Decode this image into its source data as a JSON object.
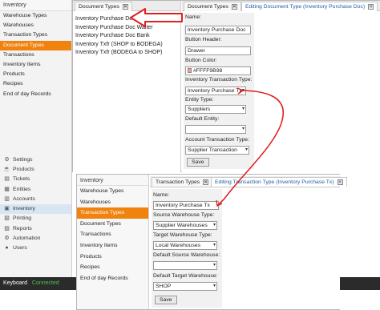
{
  "sidebar": {
    "header": "Inventory",
    "items": [
      {
        "label": "Warehouse Types",
        "active": false
      },
      {
        "label": "Warehouses",
        "active": false
      },
      {
        "label": "Transaction Types",
        "active": false
      },
      {
        "label": "Document Types",
        "active": true
      },
      {
        "label": "Transactions",
        "active": false
      },
      {
        "label": "Inventory Items",
        "active": false
      },
      {
        "label": "Products",
        "active": false
      },
      {
        "label": "Recipes",
        "active": false
      },
      {
        "label": "End of day Records",
        "active": false
      }
    ],
    "nav": [
      {
        "label": "Settings",
        "icon": "gear-icon",
        "glyph": "⚙",
        "active": false
      },
      {
        "label": "Products",
        "icon": "products-icon",
        "glyph": "☕",
        "active": false
      },
      {
        "label": "Tickets",
        "icon": "tickets-icon",
        "glyph": "▤",
        "active": false
      },
      {
        "label": "Entities",
        "icon": "entities-icon",
        "glyph": "▦",
        "active": false
      },
      {
        "label": "Accounts",
        "icon": "accounts-icon",
        "glyph": "▥",
        "active": false
      },
      {
        "label": "Inventory",
        "icon": "inventory-icon",
        "glyph": "▣",
        "active": true
      },
      {
        "label": "Printing",
        "icon": "printing-icon",
        "glyph": "▧",
        "active": false
      },
      {
        "label": "Reports",
        "icon": "reports-icon",
        "glyph": "▨",
        "active": false
      },
      {
        "label": "Automation",
        "icon": "automation-icon",
        "glyph": "⚙",
        "active": false
      },
      {
        "label": "Users",
        "icon": "users-icon",
        "glyph": "●",
        "active": false
      }
    ]
  },
  "bottombar": {
    "keyboard": "Keyboard",
    "status": "Connected"
  },
  "top": {
    "tabs": {
      "list": "Document Types",
      "list_small": "Document Types",
      "editing": "Editing Document Type (Inventory Purchase Doc)"
    },
    "documents": [
      "Inventory Purchase Doc",
      "Inventory Purchase Doc Waiter",
      "Inventory Purchase Doc Bank",
      "Inventory Txfr (SHOP to BODEGA)",
      "Inventory Txfr (BODEGA to SHOP)"
    ],
    "form": {
      "name_label": "Name:",
      "name_value": "Inventory Purchase Doc",
      "button_header_label": "Button Header:",
      "button_header_value": "Drawer",
      "button_color_label": "Button Color:",
      "button_color_value": "#FFFF9B98",
      "button_color_swatch": "#ff9b98",
      "inv_tx_type_label": "Inventory Transaction Type:",
      "inv_tx_type_value": "Inventory Purchase Tx",
      "entity_type_label": "Entity Type:",
      "entity_type_value": "Suppliers",
      "default_entity_label": "Default Entity:",
      "default_entity_value": "",
      "account_tx_type_label": "Account Transaction Type:",
      "account_tx_type_value": "Supplier Transaction",
      "save": "Save"
    }
  },
  "bottom": {
    "sidebar_header": "Inventory",
    "sidebar_items": [
      {
        "label": "Warehouse Types",
        "active": false
      },
      {
        "label": "Warehouses",
        "active": false
      },
      {
        "label": "Transaction Types",
        "active": true
      },
      {
        "label": "Document Types",
        "active": false
      },
      {
        "label": "Transactions",
        "active": false
      },
      {
        "label": "Inventory Items",
        "active": false
      },
      {
        "label": "Products",
        "active": false
      },
      {
        "label": "Recipes",
        "active": false
      },
      {
        "label": "End of day Records",
        "active": false
      }
    ],
    "tabs": {
      "list": "Transaction Types",
      "editing": "Editing Transaction Type (Inventory Purchase Tx)"
    },
    "form": {
      "name_label": "Name:",
      "name_value": "Inventory Purchase Tx",
      "source_wh_type_label": "Source Warehouse Type:",
      "source_wh_type_value": "Supplier Warehouses",
      "target_wh_type_label": "Target Warehouse Type:",
      "target_wh_type_value": "Local Warehouses",
      "default_source_wh_label": "Default Source Warehouse:",
      "default_source_wh_value": "",
      "default_target_wh_label": "Default Target Warehouse:",
      "default_target_wh_value": "SHOP",
      "save": "Save"
    }
  },
  "annotation_color": "#e02020"
}
